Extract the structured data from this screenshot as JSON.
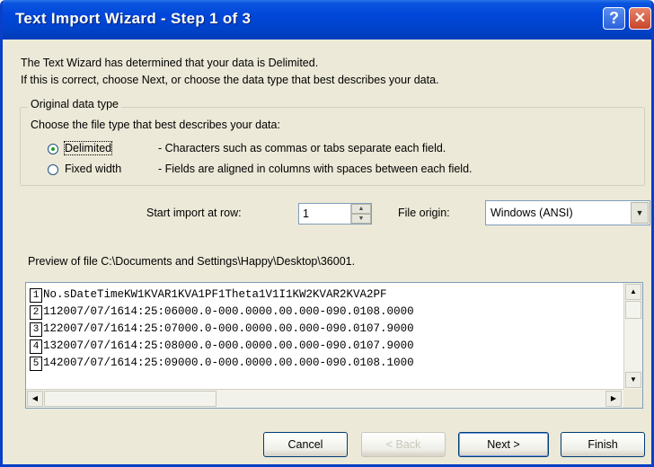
{
  "window": {
    "title": "Text Import Wizard - Step 1 of 3",
    "help_label": "?",
    "close_label": "✕"
  },
  "intro": {
    "line1": "The Text Wizard has determined that your data is Delimited.",
    "line2": "If this is correct, choose Next, or choose the data type that best describes your data."
  },
  "original_data_type": {
    "group_label": "Original data type",
    "prompt": "Choose the file type that best describes your data:",
    "options": [
      {
        "label": "Delimited",
        "description": "- Characters such as commas or tabs separate each field.",
        "selected": true
      },
      {
        "label": "Fixed width",
        "description": "- Fields are aligned in columns with spaces between each field.",
        "selected": false
      }
    ]
  },
  "start_import": {
    "label": "Start import at row:",
    "value": "1"
  },
  "file_origin": {
    "label": "File origin:",
    "value": "Windows (ANSI)"
  },
  "preview": {
    "label": "Preview of file C:\\Documents and Settings\\Happy\\Desktop\\36001.",
    "rows": [
      {
        "num": "1",
        "text": "No.sDateTimeKW1KVAR1KVA1PF1Theta1V1I1KW2KVAR2KVA2PF"
      },
      {
        "num": "2",
        "text": "112007/07/1614:25:06000.0-000.0000.00.000-090.0108.0000"
      },
      {
        "num": "3",
        "text": "122007/07/1614:25:07000.0-000.0000.00.000-090.0107.9000"
      },
      {
        "num": "4",
        "text": "132007/07/1614:25:08000.0-000.0000.00.000-090.0107.9000"
      },
      {
        "num": "5",
        "text": "142007/07/1614:25:09000.0-000.0000.00.000-090.0108.1000"
      }
    ]
  },
  "buttons": {
    "cancel": "Cancel",
    "back": "< Back",
    "next": "Next >",
    "finish": "Finish"
  },
  "icons": {
    "help": "help-icon",
    "close": "close-icon",
    "spin_up": "arrow-up-icon",
    "spin_down": "arrow-down-icon",
    "dropdown": "chevron-down-icon"
  },
  "colors": {
    "titlebar": "#0046d8",
    "dialog_bg": "#ece9d8",
    "radio_dot": "#21a121"
  }
}
